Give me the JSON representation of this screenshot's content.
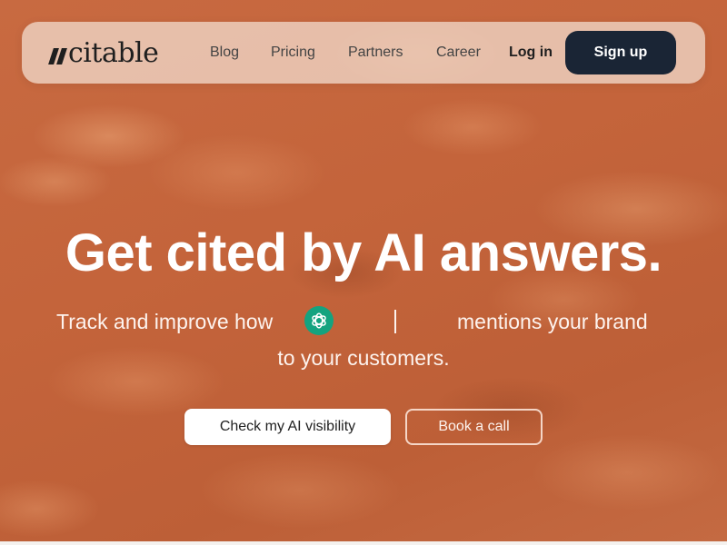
{
  "brand": {
    "name": "citable"
  },
  "nav": {
    "links": [
      "Blog",
      "Pricing",
      "Partners",
      "Career"
    ],
    "login_label": "Log in",
    "signup_label": "Sign up"
  },
  "hero": {
    "title": "Get cited by AI answers.",
    "subtitle_start": "Track and improve how",
    "subtitle_end": "mentions your brand",
    "subtitle_line2": "to your customers.",
    "rotating_icon": "chatgpt-icon",
    "primary_cta": "Check my AI visibility",
    "secondary_cta": "Book a call"
  },
  "colors": {
    "background": "#c4663e",
    "signup_button": "#1a2535",
    "chatgpt_green": "#14a37f"
  }
}
